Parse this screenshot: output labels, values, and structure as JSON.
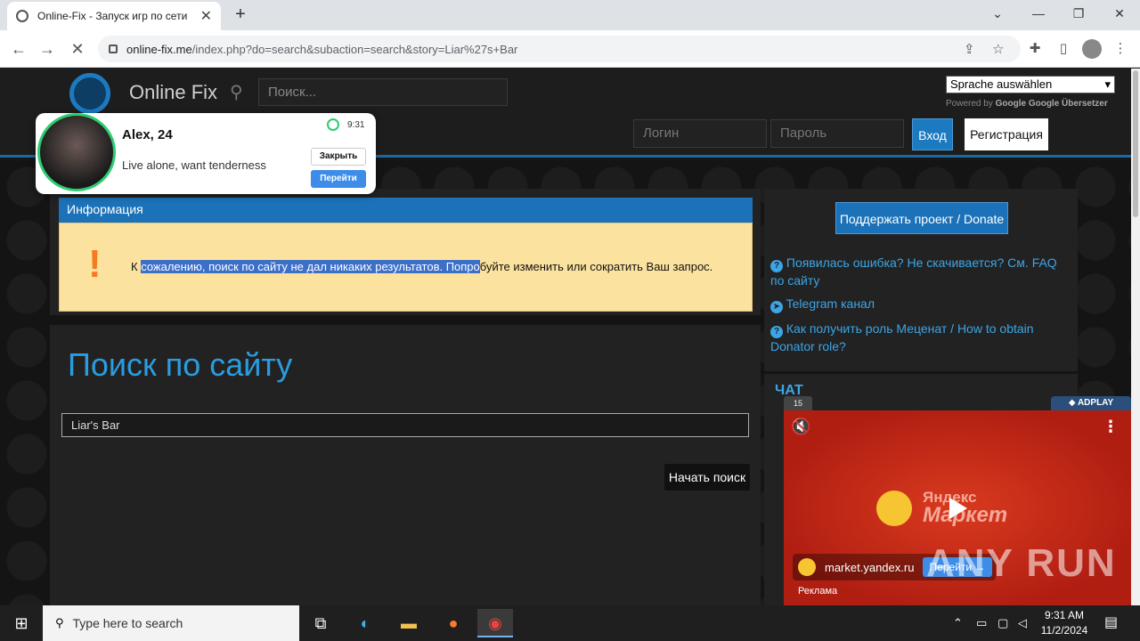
{
  "browser": {
    "tab_title": "Online-Fix - Запуск игр по сети",
    "url_host": "online-fix.me",
    "url_path": "/index.php?do=search&subaction=search&story=Liar%27s+Bar"
  },
  "site": {
    "name": "Online Fix",
    "search_placeholder": "Поиск...",
    "lang_select": "Sprache auswählen",
    "powered_by": "Powered by",
    "google": "Google",
    "translate": "Google Übersetzer",
    "login_placeholder": "Логин",
    "password_placeholder": "Пароль",
    "login_button": "Вход",
    "register_button": "Регистрация"
  },
  "info": {
    "heading": "Информация",
    "text_before": "К ",
    "text_highlight": "сожалению, поиск по сайту не дал никаких результатов. Попро",
    "text_after": "буйте изменить или сократить Ваш запрос."
  },
  "search": {
    "title": "Поиск по сайту",
    "query": "Liar's Bar",
    "submit": "Начать поиск"
  },
  "sidebar": {
    "donate": "Поддержать проект / Donate",
    "links": [
      "Появилась ошибка? Не скачивается? См. FAQ по сайту",
      "Telegram канал",
      "Как получить роль Меценат / How to obtain Donator role?"
    ],
    "chat_label": "ЧАТ"
  },
  "popup": {
    "name": "Alex, 24",
    "message": "Live alone, want tenderness",
    "time": "9:31",
    "close": "Закрыть",
    "go": "Перейти"
  },
  "ad": {
    "counter": "15",
    "brand": "ADPLAY",
    "logo_line1": "Яндекс",
    "logo_line2": "Маркет",
    "domain": "market.yandex.ru",
    "go": "Перейти →",
    "label": "Реклама"
  },
  "watermark": "ANY RUN",
  "taskbar": {
    "search_placeholder": "Type here to search",
    "time": "9:31 AM",
    "date": "11/2/2024"
  }
}
